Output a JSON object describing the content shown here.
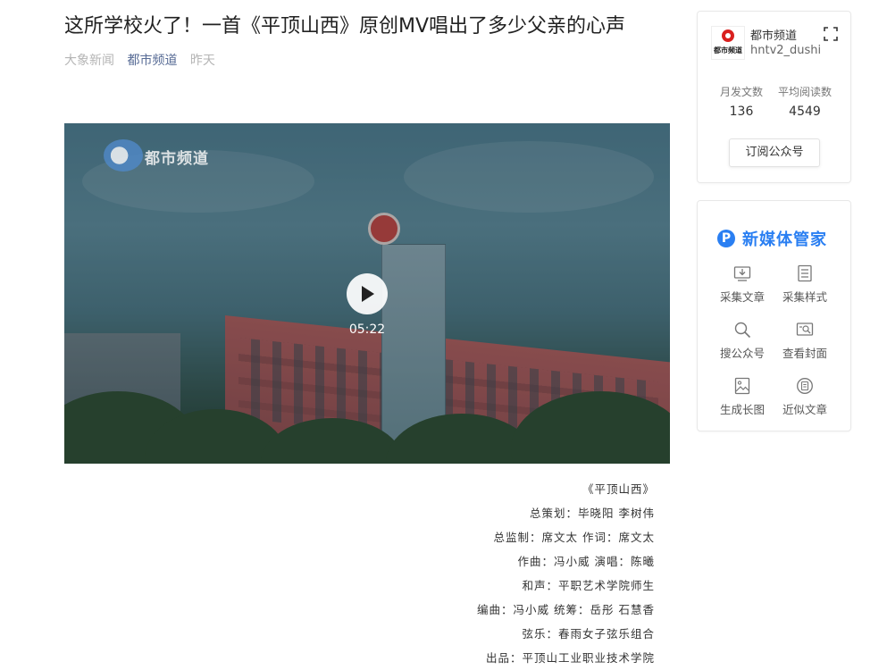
{
  "article": {
    "title": "这所学校火了！一首《平顶山西》原创MV唱出了多少父亲的心声",
    "meta": {
      "source": "大象新闻",
      "account": "都市频道",
      "time": "昨天"
    },
    "video": {
      "channel_logo_text": "都市频道",
      "duration": "05:22"
    },
    "credits": [
      "《平顶山西》",
      "总策划：毕晓阳 李树伟",
      "总监制：席文太 作词：席文太",
      "作曲：冯小威 演唱：陈曦",
      "和声：平职艺术学院师生",
      "编曲：冯小威 统筹：岳彤 石慧香",
      "弦乐：春雨女子弦乐组合",
      "出品：平顶山工业职业技术学院"
    ]
  },
  "account_card": {
    "avatar_text": "都市频道",
    "name": "都市频道",
    "id": "hntv2_dushi",
    "stats": [
      {
        "label": "月发文数",
        "value": "136"
      },
      {
        "label": "平均阅读数",
        "value": "4549"
      }
    ],
    "subscribe_label": "订阅公众号"
  },
  "tools_card": {
    "brand_icon": "P",
    "brand_name": "新媒体管家",
    "tools": [
      {
        "label": "采集文章",
        "icon": "download-icon"
      },
      {
        "label": "采集样式",
        "icon": "document-icon"
      },
      {
        "label": "搜公众号",
        "icon": "search-icon"
      },
      {
        "label": "查看封面",
        "icon": "image-search-icon"
      },
      {
        "label": "生成长图",
        "icon": "image-icon"
      },
      {
        "label": "近似文章",
        "icon": "similar-article-icon"
      }
    ]
  }
}
